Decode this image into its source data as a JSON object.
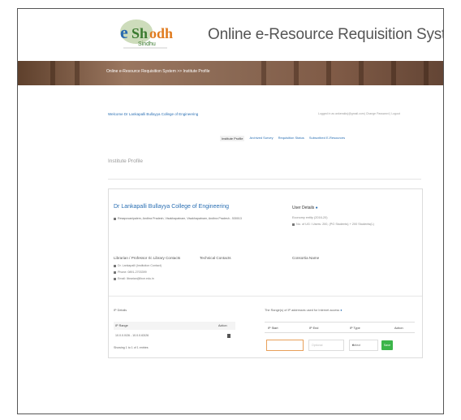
{
  "header": {
    "title": "Online e-Resource Requisition System",
    "logo_text": "e-ShodhSindhu"
  },
  "banner": {
    "breadcrumb": "Online e-Resource Requisition System >> Institute Profile"
  },
  "topbar": {
    "welcome": "Welcome Dr Lankapalli Bullayya College of Engineering",
    "logout_line": "Logged in as ankerakis(@gmail.com) Change Password | Logout"
  },
  "nav": {
    "tabs": [
      {
        "label": "Institute Profile"
      },
      {
        "label": "Archived Survey"
      },
      {
        "label": "Requisition Status"
      },
      {
        "label": "Subscribed E-Resources"
      }
    ]
  },
  "page": {
    "section_title": "Institute Profile"
  },
  "institute": {
    "name": "Dr Lankapalli Bullayya College of Engineering",
    "address": "Resapuvanipalem, Andhra Pradesh, Visakhapatnam, Visakhapatnam, Andhra Pradesh - 530013",
    "user_details_label": "User Details",
    "user_line1": "Economy entity (2016-20)",
    "user_line2": "No. of UG / Users: 200, (PG Students) + 200 Students(L)",
    "contacts_label": "Librarian / Professor I/c Library Contacts",
    "technical_label": "Technical Contacts",
    "consortia_label": "Consortia Name",
    "contact_name": "Dr. Lankapalli (Institution Contact)",
    "contact_phone": "Phone: 0891-2703399",
    "contact_email": "Email: librarian@lbce.edu.in"
  },
  "ip": {
    "section_label": "IP Details",
    "col_range": "IP Range",
    "col_action": "Action",
    "row_range": "10.0.0.0/26 - 10.0.0.63/26",
    "showing": "Showing 1 to 1 of 1 entries",
    "right_label": "The Range(s) of IP addresses used for Internet access",
    "col_start": "IP Start",
    "col_end": "IP End",
    "col_type": "IP Type",
    "col_action2": "Action",
    "end_placeholder": "Optional",
    "type_selected": "Select",
    "save_label": "Save"
  },
  "colors": {
    "accent_blue": "#2a6fb3",
    "save_green": "#3cb54a",
    "banner_brown": "#8a6a55"
  }
}
